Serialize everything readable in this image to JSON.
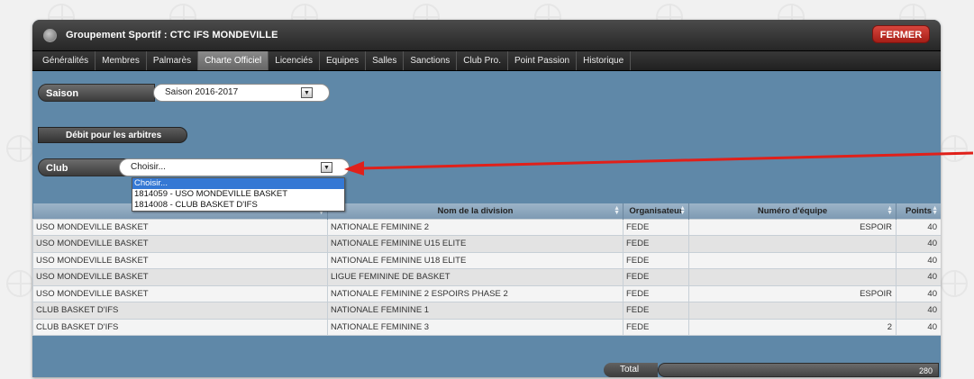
{
  "colors": {
    "accent_close": "#c9302c",
    "panel": "#5f88a8",
    "arrow": "#e0201a"
  },
  "window": {
    "title": "Groupement Sportif : CTC IFS MONDEVILLE",
    "close_label": "FERMER"
  },
  "tabs": [
    "Généralités",
    "Membres",
    "Palmarès",
    "Charte Officiel",
    "Licenciés",
    "Equipes",
    "Salles",
    "Sanctions",
    "Club Pro.",
    "Point Passion",
    "Historique"
  ],
  "active_tab": "Charte Officiel",
  "season": {
    "label": "Saison",
    "value": "Saison 2016-2017"
  },
  "debit_header": "Débit pour les arbitres",
  "club": {
    "label": "Club",
    "value": "Choisir...",
    "options": [
      "Choisir...",
      "1814059 - USO MONDEVILLE BASKET",
      "1814008 - CLUB BASKET D'IFS"
    ],
    "selected_index": 0
  },
  "table": {
    "headers": [
      "",
      "Nom de la division",
      "Organisateur",
      "Numéro d'équipe",
      "Points"
    ],
    "rows": [
      [
        "USO MONDEVILLE BASKET",
        "NATIONALE FEMININE 2",
        "FEDE",
        "ESPOIR",
        "40"
      ],
      [
        "USO MONDEVILLE BASKET",
        "NATIONALE FEMININE U15 ELITE",
        "FEDE",
        "",
        "40"
      ],
      [
        "USO MONDEVILLE BASKET",
        "NATIONALE FEMININE U18 ELITE",
        "FEDE",
        "",
        "40"
      ],
      [
        "USO MONDEVILLE BASKET",
        "LIGUE FEMININE DE BASKET",
        "FEDE",
        "",
        "40"
      ],
      [
        "USO MONDEVILLE BASKET",
        "NATIONALE FEMININE 2 ESPOIRS PHASE 2",
        "FEDE",
        "ESPOIR",
        "40"
      ],
      [
        "CLUB BASKET D'IFS",
        "NATIONALE FEMININE 1",
        "FEDE",
        "",
        "40"
      ],
      [
        "CLUB BASKET D'IFS",
        "NATIONALE FEMININE 3",
        "FEDE",
        "2",
        "40"
      ]
    ]
  },
  "total": {
    "label": "Total",
    "value": "280"
  }
}
